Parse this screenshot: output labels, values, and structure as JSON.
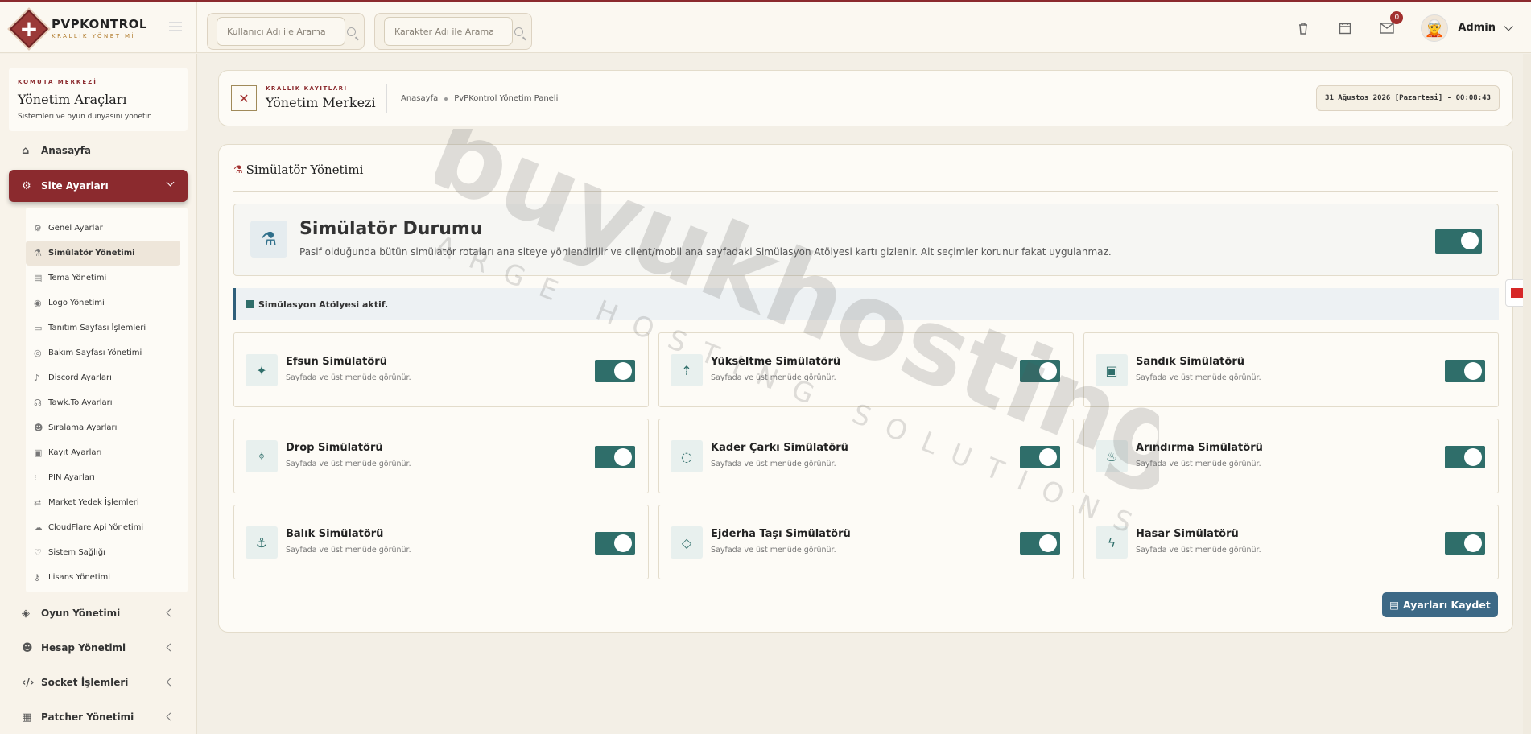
{
  "brand": {
    "title": "PVPKONTROL",
    "subtitle": "KRALLIK YÖNETİMİ"
  },
  "header": {
    "search_user_placeholder": "Kullanıcı Adı ile Arama",
    "search_char_placeholder": "Karakter Adı ile Arama",
    "notification_count": "0",
    "user_name": "Admin"
  },
  "sidebar": {
    "kicker": "KOMUTA MERKEZİ",
    "title": "Yönetim Araçları",
    "subtitle": "Sistemleri ve oyun dünyasını yönetin",
    "home": "Anasayfa",
    "site_settings": "Site Ayarları",
    "sub_items": [
      "Genel Ayarlar",
      "Simülatör Yönetimi",
      "Tema Yönetimi",
      "Logo Yönetimi",
      "Tanıtım Sayfası İşlemleri",
      "Bakım Sayfası Yönetimi",
      "Discord Ayarları",
      "Tawk.To Ayarları",
      "Sıralama Ayarları",
      "Kayıt Ayarları",
      "PIN Ayarları",
      "Market Yedek İşlemleri",
      "CloudFlare Api Yönetimi",
      "Sistem Sağlığı",
      "Lisans Yönetimi"
    ],
    "groups": [
      "Oyun Yönetimi",
      "Hesap Yönetimi",
      "Socket İşlemleri",
      "Patcher Yönetimi"
    ]
  },
  "breadcrumb": {
    "kicker": "KRALLIK KAYITLARI",
    "title": "Yönetim Merkezi",
    "home": "Anasayfa",
    "current": "PvPKontrol Yönetim Paneli",
    "date": "31 Ağustos 2026 [Pazartesi] - 00:08:43"
  },
  "main": {
    "title": "Simülatör Yönetimi",
    "status_title": "Simülatör Durumu",
    "status_desc": "Pasif olduğunda bütün simülatör rotaları ana siteye yönlendirilir ve client/mobil ana sayfadaki Simülasyon Atölyesi kartı gizlenir. Alt seçimler korunur fakat uygulanmaz.",
    "status_enabled": true,
    "alert": "Simülasyon Atölyesi aktif.",
    "simulators": [
      {
        "name": "Efsun Simülatörü",
        "sub": "Sayfada ve üst menüde görünür.",
        "icon": "magic-wand-icon",
        "enabled": true
      },
      {
        "name": "Yükseltme Simülatörü",
        "sub": "Sayfada ve üst menüde görünür.",
        "icon": "upgrade-arrow-icon",
        "enabled": true
      },
      {
        "name": "Sandık Simülatörü",
        "sub": "Sayfada ve üst menüde görünür.",
        "icon": "chest-icon",
        "enabled": true
      },
      {
        "name": "Drop Simülatörü",
        "sub": "Sayfada ve üst menüde görünür.",
        "icon": "crosshair-icon",
        "enabled": true
      },
      {
        "name": "Kader Çarkı Simülatörü",
        "sub": "Sayfada ve üst menüde görünür.",
        "icon": "wheel-icon",
        "enabled": true
      },
      {
        "name": "Arındırma Simülatörü",
        "sub": "Sayfada ve üst menüde görünür.",
        "icon": "flame-icon",
        "enabled": true
      },
      {
        "name": "Balık Simülatörü",
        "sub": "Sayfada ve üst menüde görünür.",
        "icon": "anchor-icon",
        "enabled": true
      },
      {
        "name": "Ejderha Taşı Simülatörü",
        "sub": "Sayfada ve üst menüde görünür.",
        "icon": "gem-icon",
        "enabled": true
      },
      {
        "name": "Hasar Simülatörü",
        "sub": "Sayfada ve üst menüde görünür.",
        "icon": "bolt-icon",
        "enabled": true
      }
    ],
    "save_label": "Ayarları Kaydet"
  },
  "watermark": {
    "main": "buyukhosting",
    "sub": "LARGE HOSTING SOLUTIONS"
  },
  "colors": {
    "accent": "#8b2a2e",
    "toggle": "#2f6e6a",
    "save": "#3d6986"
  }
}
